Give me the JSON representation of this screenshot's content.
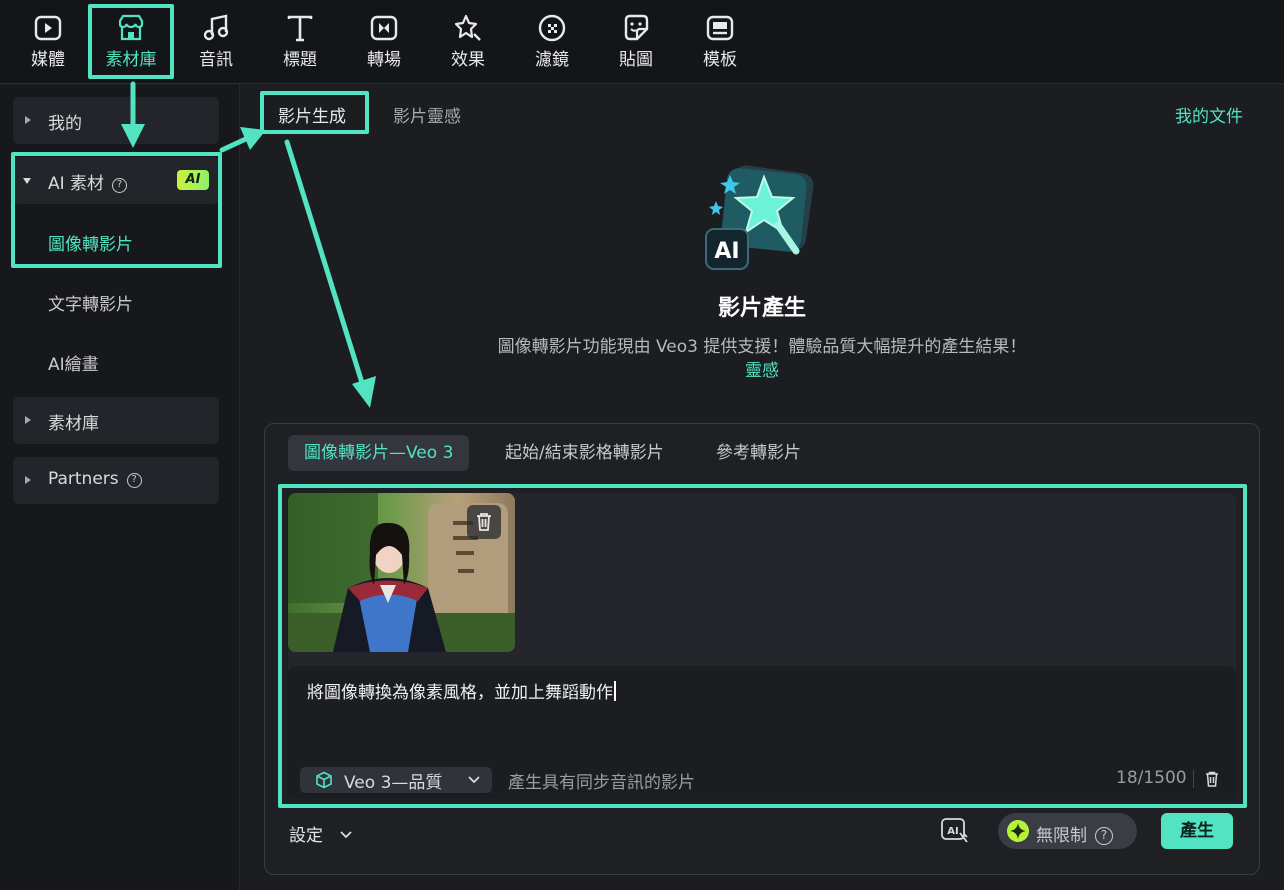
{
  "toolbar": {
    "items": [
      {
        "label": "媒體",
        "icon": "media-icon"
      },
      {
        "label": "素材庫",
        "icon": "store-icon"
      },
      {
        "label": "音訊",
        "icon": "music-note-icon"
      },
      {
        "label": "標題",
        "icon": "text-icon"
      },
      {
        "label": "轉場",
        "icon": "transition-icon"
      },
      {
        "label": "效果",
        "icon": "effects-icon"
      },
      {
        "label": "濾鏡",
        "icon": "filter-icon"
      },
      {
        "label": "貼圖",
        "icon": "sticker-icon"
      },
      {
        "label": "模板",
        "icon": "template-icon"
      }
    ],
    "active_index": 1
  },
  "sidebar": {
    "my": "我的",
    "ai_group": "AI 素材",
    "ai_badge": "AI",
    "ai_items": [
      "圖像轉影片",
      "文字轉影片",
      "AI繪畫"
    ],
    "library": "素材庫",
    "partners": "Partners"
  },
  "main": {
    "tabs": [
      "影片生成",
      "影片靈感"
    ],
    "my_files": "我的文件",
    "hero": {
      "title": "影片產生",
      "subtitle": "圖像轉影片功能現由 Veo3 提供支援！體驗品質大幅提升的產生結果！",
      "link": "靈感"
    },
    "panel": {
      "tabs": [
        "圖像轉影片—Veo 3",
        "起始/結束影格轉影片",
        "參考轉影片"
      ],
      "prompt": "將圖像轉換為像素風格，並加上舞蹈動作",
      "model": "Veo 3—品質",
      "hint": "產生具有同步音訊的影片",
      "counter": "18/1500",
      "settings": "設定",
      "unlimited": "無限制",
      "generate": "產生"
    }
  },
  "colors": {
    "accent": "#52e3c2",
    "background": "#1b1d21",
    "toolbar": "#141518"
  }
}
